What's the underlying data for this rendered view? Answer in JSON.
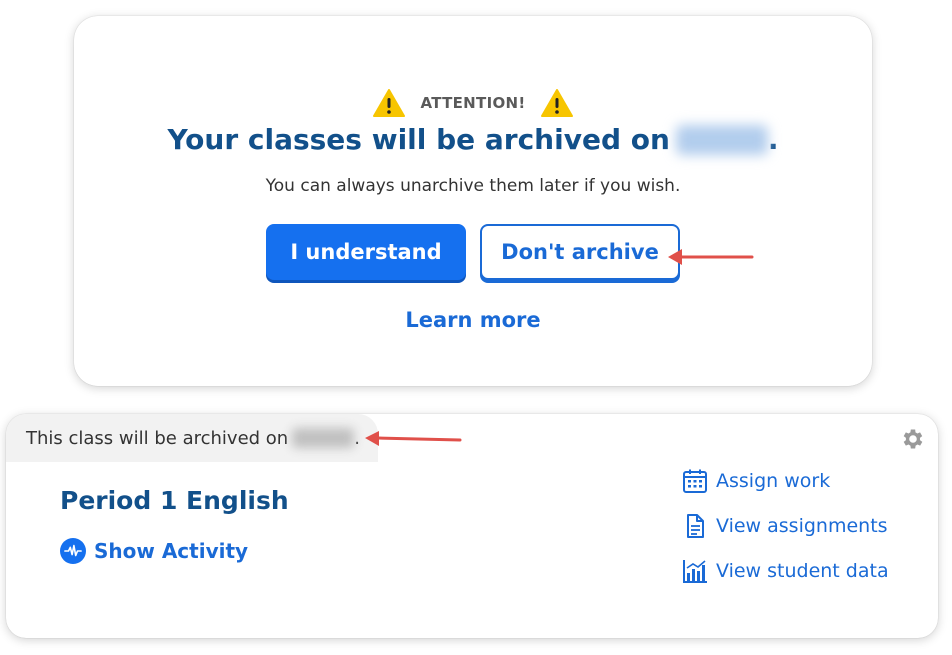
{
  "alert": {
    "attention_label": "ATTENTION!",
    "headline_prefix": "Your classes will be archived on",
    "headline_suffix": ".",
    "subline": "You can always unarchive them later if you wish.",
    "understand_button": "I understand",
    "dont_archive_button": "Don't archive",
    "learn_more": "Learn more"
  },
  "class_card": {
    "banner_text": "This class will be archived on",
    "banner_suffix": ".",
    "class_name": "Period 1 English",
    "show_activity": "Show Activity",
    "actions": [
      {
        "label": "Assign work",
        "icon": "calendar-icon"
      },
      {
        "label": "View assignments",
        "icon": "document-icon"
      },
      {
        "label": "View student data",
        "icon": "bar-chart-icon"
      }
    ]
  },
  "colors": {
    "primary_blue": "#1570ef",
    "link_blue": "#1a6ad6",
    "heading_navy": "#12508a",
    "warning_yellow": "#f7c500",
    "annotation_red": "#e0504a"
  }
}
